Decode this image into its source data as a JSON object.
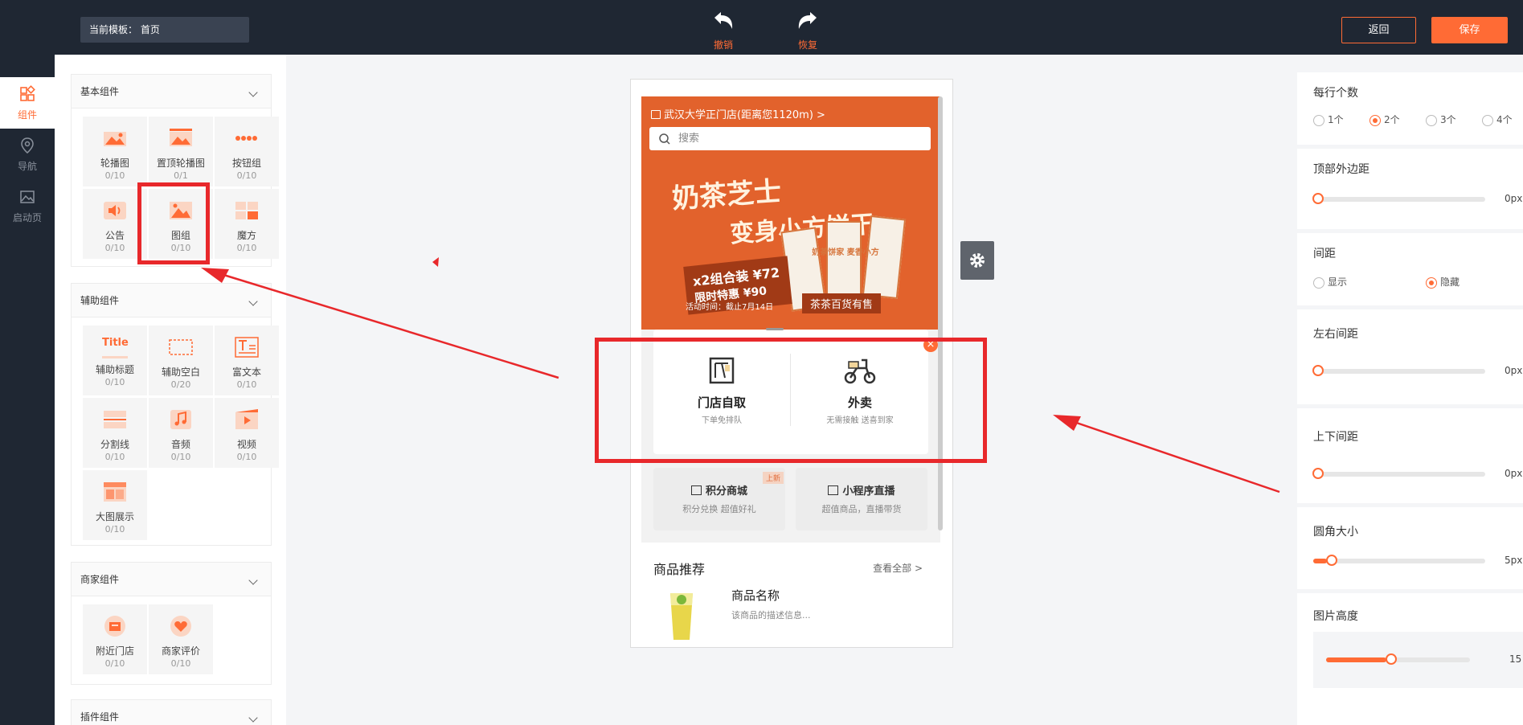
{
  "topbar": {
    "template_label": "当前模板：",
    "template_value": "首页",
    "undo_label": "撤销",
    "redo_label": "恢复",
    "back_label": "返回",
    "save_label": "保存",
    "accent_color": "#ff6b35"
  },
  "leftnav": {
    "items": [
      {
        "label": "组件",
        "icon": "components-icon",
        "active": true
      },
      {
        "label": "导航",
        "icon": "location-pin-icon"
      },
      {
        "label": "启动页",
        "icon": "image-icon"
      }
    ]
  },
  "panel": {
    "groups": [
      {
        "title": "基本组件",
        "items": [
          {
            "label": "轮播图",
            "count": "0/10",
            "icon": "carousel-icon"
          },
          {
            "label": "置顶轮播图",
            "count": "0/1",
            "icon": "top-carousel-icon"
          },
          {
            "label": "按钮组",
            "count": "0/10",
            "icon": "button-group-icon"
          },
          {
            "label": "公告",
            "count": "0/10",
            "icon": "speaker-icon"
          },
          {
            "label": "图组",
            "count": "0/10",
            "icon": "image-group-icon"
          },
          {
            "label": "魔方",
            "count": "0/10",
            "icon": "magic-cube-icon"
          }
        ]
      },
      {
        "title": "辅助组件",
        "items": [
          {
            "label": "辅助标题",
            "count": "0/10",
            "icon": "title-icon",
            "icon_text": "Title"
          },
          {
            "label": "辅助空白",
            "count": "0/20",
            "icon": "blank-space-icon"
          },
          {
            "label": "富文本",
            "count": "0/10",
            "icon": "rich-text-icon"
          },
          {
            "label": "分割线",
            "count": "0/10",
            "icon": "divider-icon"
          },
          {
            "label": "音频",
            "count": "0/10",
            "icon": "music-note-icon"
          },
          {
            "label": "视频",
            "count": "0/10",
            "icon": "video-icon"
          },
          {
            "label": "大图展示",
            "count": "0/10",
            "icon": "large-image-icon"
          }
        ]
      },
      {
        "title": "商家组件",
        "items": [
          {
            "label": "附近门店",
            "count": "0/10",
            "icon": "shop-icon"
          },
          {
            "label": "商家评价",
            "count": "0/10",
            "icon": "heart-icon"
          }
        ]
      },
      {
        "title": "插件组件",
        "items": []
      }
    ]
  },
  "phone": {
    "store_line": "武汉大学正门店(距离您1120m) >",
    "search_placeholder": "搜索",
    "hero": {
      "title_line1": "奶茶芝士",
      "title_line2": "变身小方饼干",
      "price_line1": "x2组合装 ¥72",
      "price_line2": "限时特惠 ¥90",
      "product_text": "奶茶饼家 麦香小方",
      "banner": "茶茶百货有售",
      "activity": "活动时间：截止7月14日"
    },
    "order": {
      "pickup_title": "门店自取",
      "pickup_sub": "下单免排队",
      "delivery_title": "外卖",
      "delivery_sub": "无需接触 送喜到家"
    },
    "mini_cards": [
      {
        "title": "积分商城",
        "sub": "积分兑换 超值好礼",
        "badge": "上新"
      },
      {
        "title": "小程序直播",
        "sub": "超值商品，直播带货"
      }
    ],
    "recommend": {
      "title": "商品推荐",
      "view_all": "查看全部 >",
      "product_name": "商品名称",
      "product_desc": "该商品的描述信息..."
    }
  },
  "settings": {
    "per_row": {
      "label": "每行个数",
      "options": [
        "1个",
        "2个",
        "3个",
        "4个"
      ],
      "selected": "2个"
    },
    "top_margin": {
      "label": "顶部外边距",
      "value": "0px",
      "level": 0
    },
    "spacing": {
      "label": "间距",
      "options": [
        "显示",
        "隐藏"
      ],
      "selected": "隐藏"
    },
    "lr_spacing": {
      "label": "左右间距",
      "value": "0px",
      "level": 0
    },
    "ud_spacing": {
      "label": "上下间距",
      "value": "0px",
      "level": 0
    },
    "radius": {
      "label": "圆角大小",
      "value": "5px",
      "level": 0.08
    },
    "image_height": {
      "label": "图片高度",
      "value": "15",
      "level": 0.42
    }
  }
}
